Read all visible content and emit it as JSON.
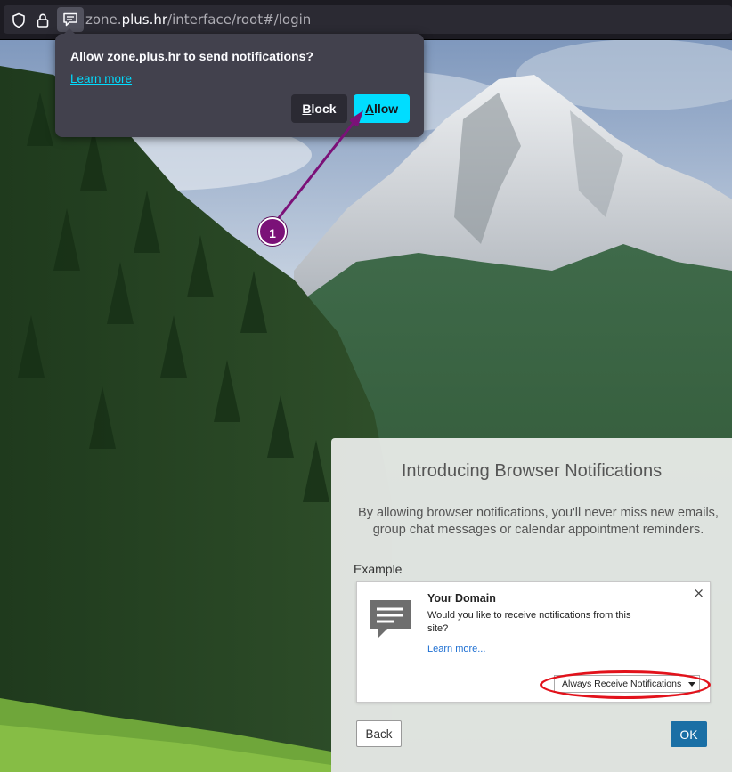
{
  "browser": {
    "url_prefix": "zone.",
    "url_domain": "plus.hr",
    "url_path": "/interface/root#/login"
  },
  "permission_prompt": {
    "title": "Allow zone.plus.hr to send notifications?",
    "learn_more": "Learn more",
    "block_first": "B",
    "block_rest": "lock",
    "allow_first": "A",
    "allow_rest": "llow"
  },
  "annotation": {
    "step": "1",
    "color": "#7b1178"
  },
  "intro_panel": {
    "title": "Introducing Browser Notifications",
    "description": "By allowing browser notifications, you'll never miss new emails, group chat messages or calendar appointment reminders.",
    "example_label": "Example",
    "example": {
      "icon": "message-bubble-icon",
      "title": "Your Domain",
      "message": "Would you like to receive notifications from this site?",
      "learn_more": "Learn more...",
      "close": "×",
      "select_value": "Always Receive Notifications",
      "highlight_color": "#e2121b"
    },
    "back_label": "Back",
    "ok_label": "OK"
  },
  "colors": {
    "allow_accent": "#00ddff",
    "ok_button": "#1a6fa5"
  }
}
